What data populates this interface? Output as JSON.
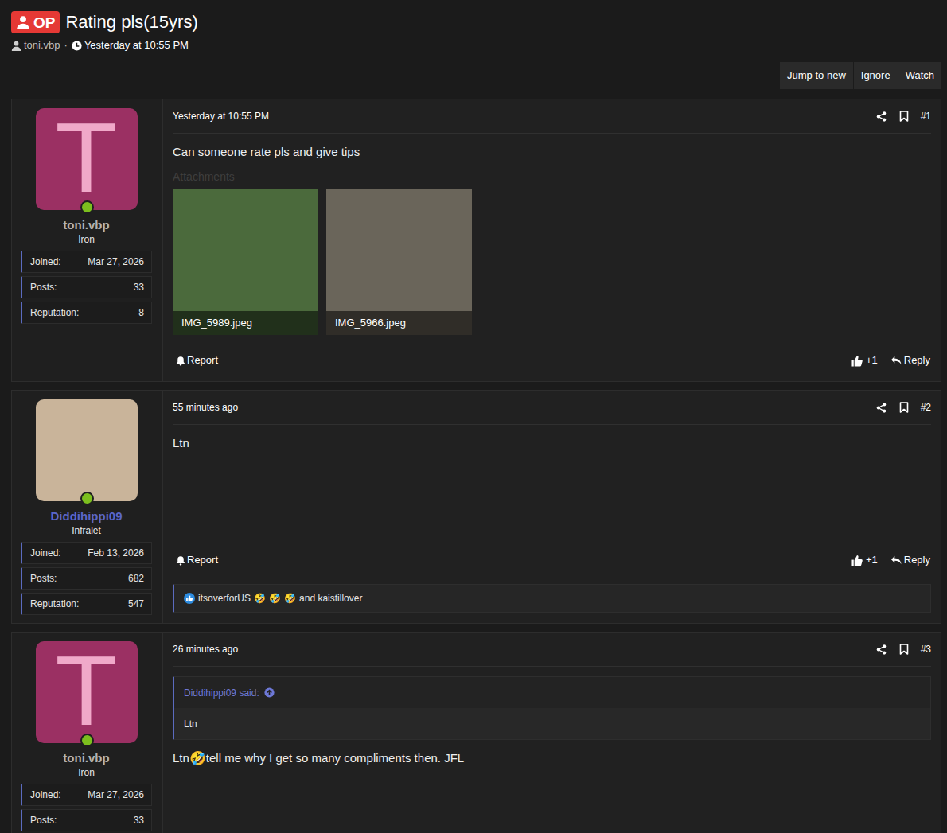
{
  "thread": {
    "badge": "OP",
    "title": "Rating pls(15yrs)",
    "author": "toni.vbp",
    "separator": "·",
    "time": "Yesterday at 10:55 PM"
  },
  "actions": [
    "Jump to new",
    "Ignore",
    "Watch"
  ],
  "posts": [
    {
      "author": {
        "name": "toni.vbp",
        "name_color": "#b3b3b3",
        "avatar_kind": "letter",
        "avatar_letter": "T",
        "online": true,
        "rank": "Iron",
        "stats": [
          {
            "label": "Joined:",
            "value": "Mar 27, 2026"
          },
          {
            "label": "Posts:",
            "value": "33"
          },
          {
            "label": "Reputation:",
            "value": "8"
          }
        ]
      },
      "time": "Yesterday at 10:55 PM",
      "number": "#1",
      "quote": null,
      "body": [
        {
          "kind": "text",
          "text": "Can someone rate pls and give tips"
        }
      ],
      "attachments_label": "Attachments",
      "attachments": [
        {
          "filename": "IMG_5989.jpeg",
          "color": "#4b6a3c"
        },
        {
          "filename": "IMG_5966.jpeg",
          "color": "#6a655a"
        }
      ],
      "report": "Report",
      "likes": "+1",
      "reply": "Reply",
      "reactions": null
    },
    {
      "author": {
        "name": "Diddihippi09",
        "name_color": "#5a66c9",
        "avatar_kind": "photo",
        "avatar_letter": "",
        "online": true,
        "rank": "Infralet",
        "stats": [
          {
            "label": "Joined:",
            "value": "Feb 13, 2026"
          },
          {
            "label": "Posts:",
            "value": "682"
          },
          {
            "label": "Reputation:",
            "value": "547"
          }
        ]
      },
      "time": "55 minutes ago",
      "number": "#2",
      "quote": null,
      "body": [
        {
          "kind": "text",
          "text": "Ltn"
        }
      ],
      "attachments_label": null,
      "attachments": [],
      "report": "Report",
      "likes": "+1",
      "reply": "Reply",
      "reactions": {
        "first_user": "itsoverforUS",
        "emojis": [
          "🤣",
          "🤣",
          "🤣"
        ],
        "rest": "and kaistillover"
      }
    },
    {
      "author": {
        "name": "toni.vbp",
        "name_color": "#b3b3b3",
        "avatar_kind": "letter",
        "avatar_letter": "T",
        "online": true,
        "rank": "Iron",
        "stats": [
          {
            "label": "Joined:",
            "value": "Mar 27, 2026"
          },
          {
            "label": "Posts:",
            "value": "33"
          }
        ]
      },
      "time": "26 minutes ago",
      "number": "#3",
      "quote": {
        "author": "Diddihippi09 said:",
        "text": "Ltn"
      },
      "body": [
        {
          "kind": "text",
          "text": "Ltn"
        },
        {
          "kind": "emoji",
          "text": "🤣"
        },
        {
          "kind": "text",
          "text": "tell me why I get so many compliments then. JFL"
        }
      ],
      "attachments_label": null,
      "attachments": [],
      "report": null,
      "likes": null,
      "reply": null,
      "reactions": null
    }
  ]
}
